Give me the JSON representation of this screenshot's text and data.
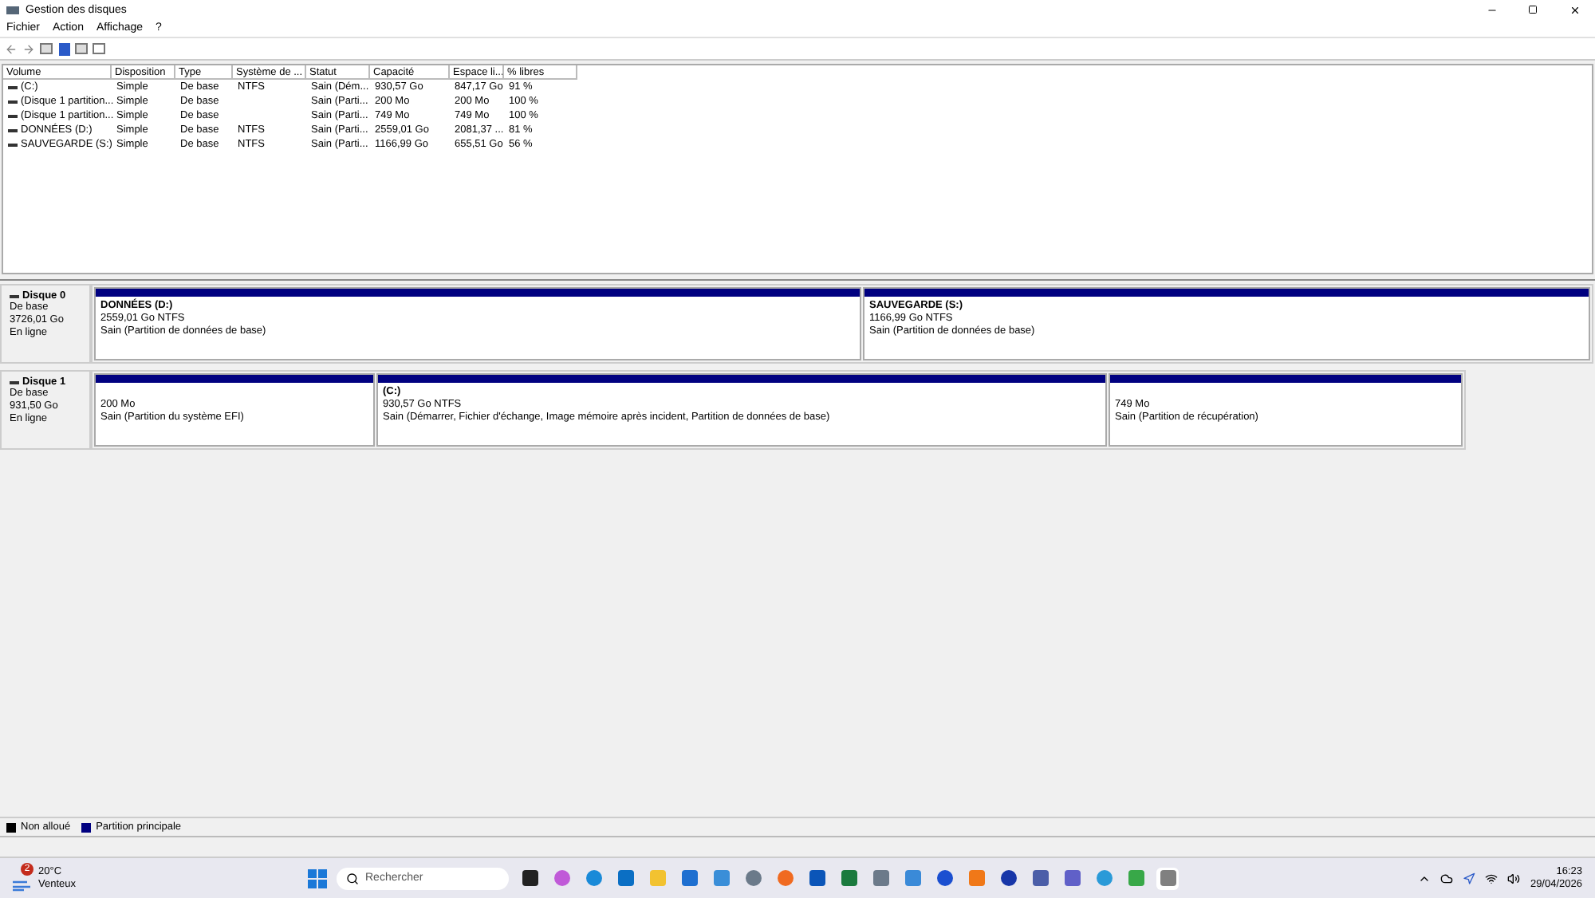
{
  "window": {
    "title": "Gestion des disques"
  },
  "menu": [
    "Fichier",
    "Action",
    "Affichage",
    "?"
  ],
  "table": {
    "columns": [
      "Volume",
      "Disposition",
      "Type",
      "Système de ...",
      "Statut",
      "Capacité",
      "Espace li...",
      "% libres"
    ],
    "rows": [
      [
        "(C:)",
        "Simple",
        "De base",
        "NTFS",
        "Sain (Dém...",
        "930,57 Go",
        "847,17 Go",
        "91 %"
      ],
      [
        "(Disque 1 partition...",
        "Simple",
        "De base",
        "",
        "Sain (Parti...",
        "200 Mo",
        "200 Mo",
        "100 %"
      ],
      [
        "(Disque 1 partition...",
        "Simple",
        "De base",
        "",
        "Sain (Parti...",
        "749 Mo",
        "749 Mo",
        "100 %"
      ],
      [
        "DONNÉES (D:)",
        "Simple",
        "De base",
        "NTFS",
        "Sain (Parti...",
        "2559,01 Go",
        "2081,37 ...",
        "81 %"
      ],
      [
        "SAUVEGARDE (S:)",
        "Simple",
        "De base",
        "NTFS",
        "Sain (Parti...",
        "1166,99 Go",
        "655,51 Go",
        "56 %"
      ]
    ]
  },
  "disks": [
    {
      "name": "Disque 0",
      "type": "De base",
      "size": "3726,01 Go",
      "status": "En ligne",
      "partitions": [
        {
          "name": "DONNÉES  (D:)",
          "size": "2559,01 Go NTFS",
          "status": "Sain (Partition de données de base)"
        },
        {
          "name": "SAUVEGARDE  (S:)",
          "size": "1166,99 Go NTFS",
          "status": "Sain (Partition de données de base)"
        }
      ]
    },
    {
      "name": "Disque 1",
      "type": "De base",
      "size": "931,50 Go",
      "status": "En ligne",
      "partitions": [
        {
          "size": "200 Mo",
          "status": "Sain (Partition du système EFI)"
        },
        {
          "name": "(C:)",
          "size": "930,57 Go NTFS",
          "status": "Sain (Démarrer, Fichier d'échange, Image mémoire après incident, Partition de données de base)"
        },
        {
          "size": "749 Mo",
          "status": "Sain (Partition de récupération)"
        }
      ]
    }
  ],
  "legend": [
    {
      "label": "Non alloué",
      "color": "#000000"
    },
    {
      "label": "Partition principale",
      "color": "#000080"
    }
  ],
  "taskbar": {
    "weather": {
      "badge": "2",
      "temp": "20°C",
      "condition": "Venteux"
    },
    "search": {
      "placeholder": "Rechercher"
    },
    "time": "16:23",
    "date": "29/04/2026"
  }
}
